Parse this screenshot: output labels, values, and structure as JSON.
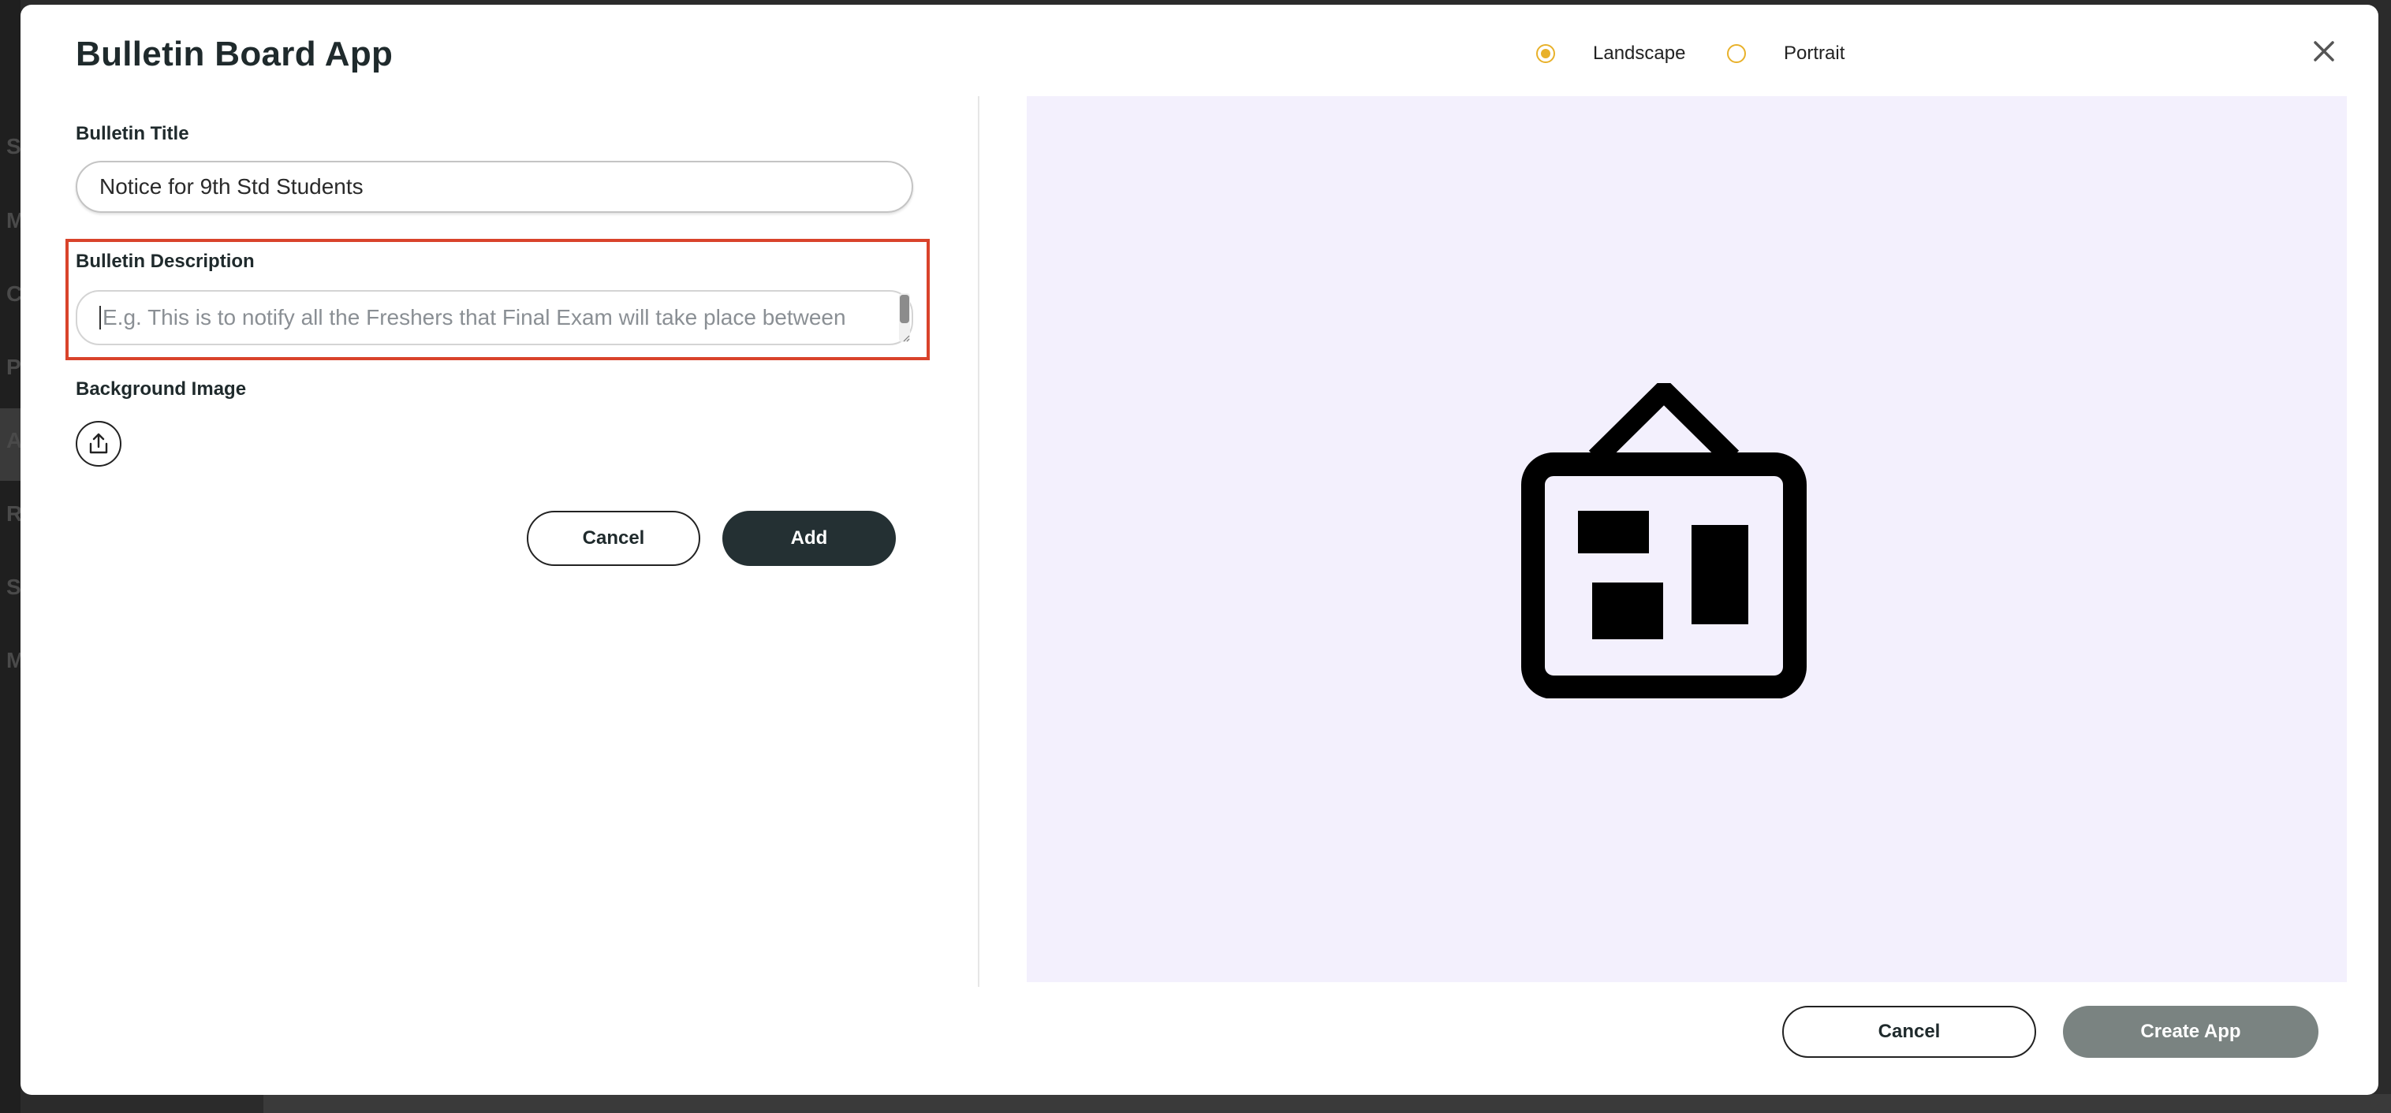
{
  "background": {
    "sidebar_letters": [
      "S",
      "M",
      "C",
      "P",
      "A",
      "R",
      "S",
      "M"
    ]
  },
  "modal": {
    "title": "Bulletin Board App",
    "close_icon": "close-icon"
  },
  "orientation": {
    "options": [
      {
        "label": "Landscape",
        "selected": true
      },
      {
        "label": "Portrait",
        "selected": false
      }
    ],
    "accent_color": "#e8b12a"
  },
  "form": {
    "bulletin_title_label": "Bulletin Title",
    "bulletin_title_value": "Notice for 9th Std Students",
    "bulletin_description_label": "Bulletin Description",
    "bulletin_description_placeholder": "E.g. This is to notify all the Freshers that Final Exam will take place between",
    "background_image_label": "Background Image",
    "upload_icon": "upload-icon",
    "cancel_label": "Cancel",
    "add_label": "Add"
  },
  "preview": {
    "icon": "bulletin-board-icon",
    "background_color": "#f3f0fd"
  },
  "footer": {
    "cancel_label": "Cancel",
    "create_label": "Create App"
  },
  "colors": {
    "highlight": "#d9432b",
    "dark_button": "#243033",
    "disabled_button": "#7a8381"
  }
}
